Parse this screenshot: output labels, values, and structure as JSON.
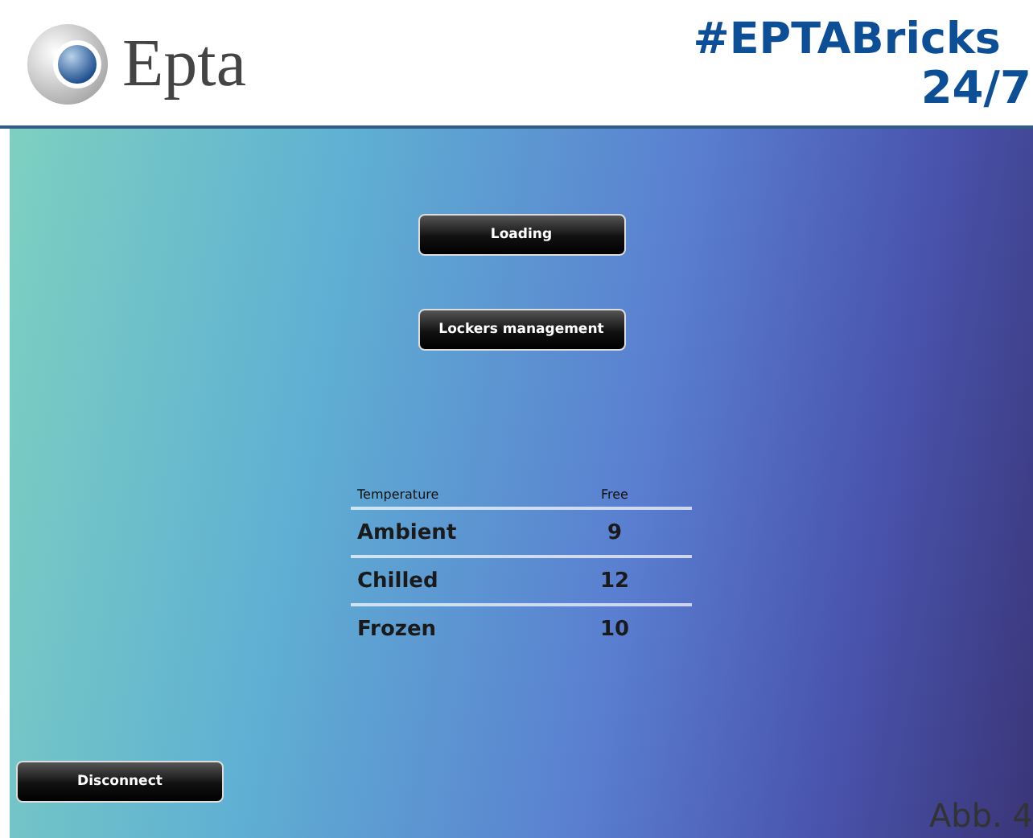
{
  "header": {
    "logo_text": "Epta",
    "slogan_line_1": "#EPTABricks",
    "slogan_line_2": "24/7"
  },
  "buttons": [
    "Loading",
    "Lockers management"
  ],
  "table": {
    "columns": [
      "Temperature",
      "Free"
    ],
    "rows": [
      {
        "temperature": "Ambient",
        "free": "9"
      },
      {
        "temperature": "Chilled",
        "free": "12"
      },
      {
        "temperature": "Frozen",
        "free": "10"
      }
    ]
  },
  "disconnect_button": "Disconnect",
  "caption": "Abb. 4"
}
